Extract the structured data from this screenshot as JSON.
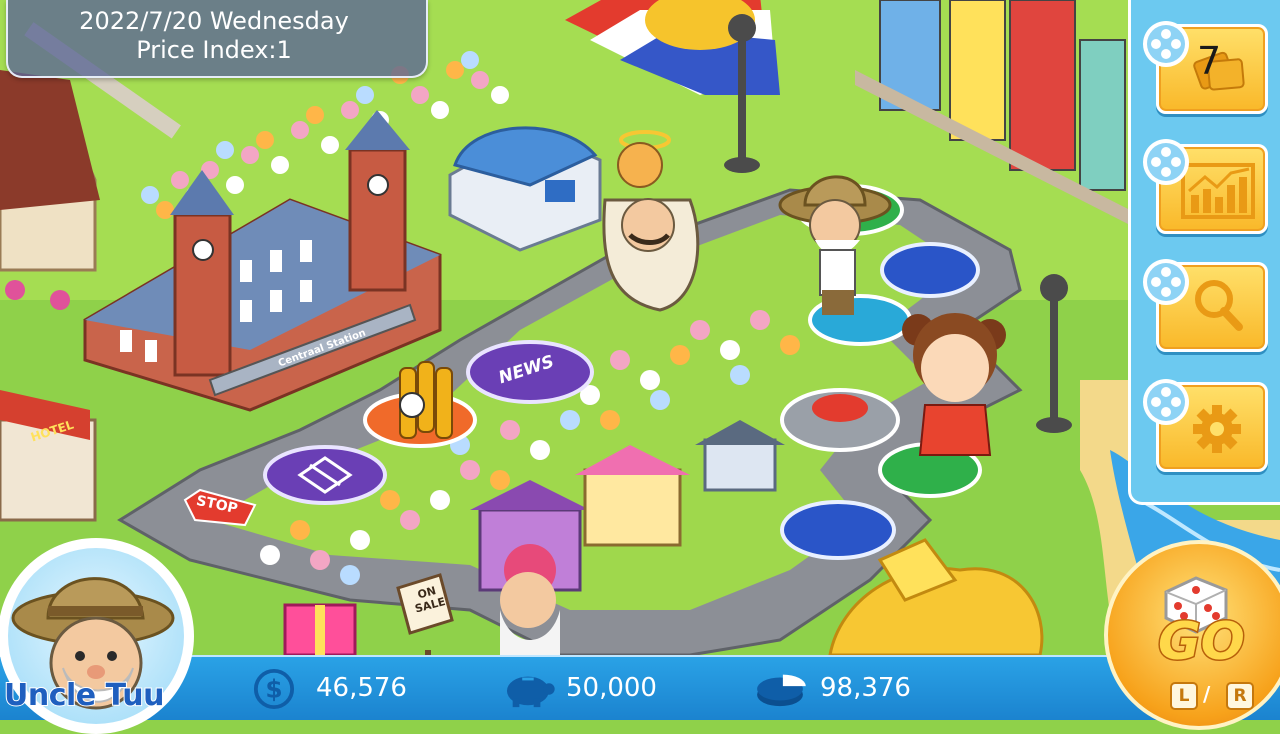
{
  "info": {
    "date": "2022/7/20 Wednesday",
    "price_index": "Price Index:1"
  },
  "board": {
    "news_tile": "NEWS",
    "stop_sign": "STOP",
    "station_sign": "Centraal Station",
    "hotel_sign": "HOTEL",
    "sale_sign_line1": "ON",
    "sale_sign_line2": "SALE"
  },
  "sidebar": {
    "cards_count": "7",
    "buttons": [
      {
        "icon": "cards-icon"
      },
      {
        "icon": "stock-chart-icon"
      },
      {
        "icon": "magnifier-icon"
      },
      {
        "icon": "settings-gear-icon"
      }
    ]
  },
  "player": {
    "name": "Uncle Tuu"
  },
  "stats": {
    "cash": "46,576",
    "savings": "50,000",
    "assets": "98,376"
  },
  "go_button": {
    "label": "GO",
    "left_key": "L",
    "right_key": "R",
    "separator": "/"
  },
  "colors": {
    "grass": "#8fd14a",
    "road": "#8c8f96",
    "panel_blue": "#2aa2e6",
    "button_yellow": "#f9b829"
  }
}
